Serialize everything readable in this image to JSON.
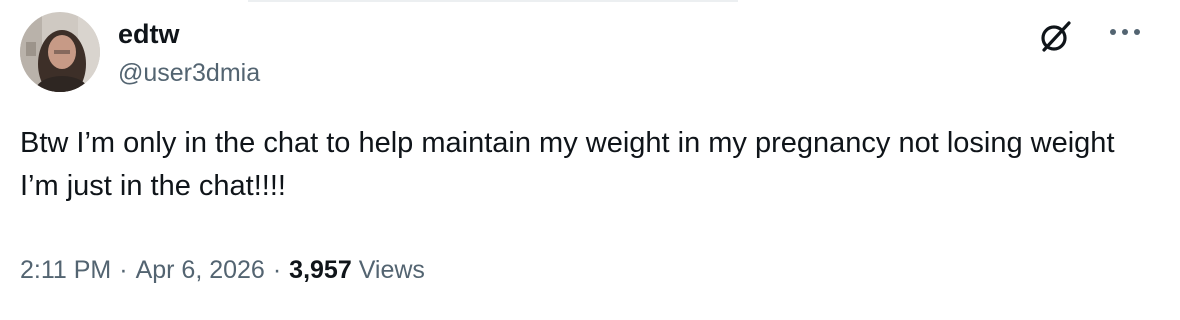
{
  "author": {
    "display_name": "edtw",
    "handle": "@user3dmia",
    "avatar_icon": "profile-photo"
  },
  "actions": {
    "grok_icon": "grok-icon",
    "more_icon": "more-horizontal-icon"
  },
  "tweet": {
    "text": "Btw I’m only in the chat to help maintain my weight in my pregnancy not losing weight I’m just in the chat!!!!"
  },
  "meta": {
    "time": "2:11 PM",
    "separator": "·",
    "date": "Apr 6, 2026",
    "views_count": "3,957",
    "views_label": "Views"
  },
  "colors": {
    "text_primary": "#0f1419",
    "text_secondary": "#536471"
  }
}
